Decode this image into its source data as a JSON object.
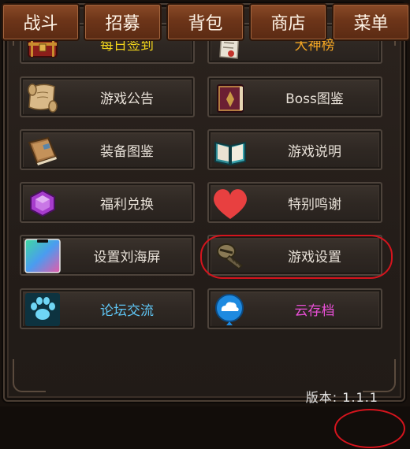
{
  "menu": {
    "buttons": [
      {
        "label": "每日签到",
        "color": "#f2d41a",
        "icon": "treasure-chest-icon"
      },
      {
        "label": "大神榜",
        "color": "#f5a623",
        "icon": "scroll-icon"
      },
      {
        "label": "游戏公告",
        "color": "#e8e1d8",
        "icon": "parchment-icon"
      },
      {
        "label": "Boss图鉴",
        "color": "#e8e1d8",
        "icon": "spellbook-icon"
      },
      {
        "label": "装备图鉴",
        "color": "#e8e1d8",
        "icon": "tome-icon"
      },
      {
        "label": "游戏说明",
        "color": "#e8e1d8",
        "icon": "open-book-icon"
      },
      {
        "label": "福利兑换",
        "color": "#e8e1d8",
        "icon": "purple-gem-icon"
      },
      {
        "label": "特别鸣谢",
        "color": "#e8e1d8",
        "icon": "heart-icon"
      },
      {
        "label": "设置刘海屏",
        "color": "#e8e1d8",
        "icon": "phone-screen-icon"
      },
      {
        "label": "游戏设置",
        "color": "#e8e1d8",
        "icon": "screw-icon"
      },
      {
        "label": "论坛交流",
        "color": "#5fc6f5",
        "icon": "paw-icon"
      },
      {
        "label": "云存档",
        "color": "#e84fd6",
        "icon": "cloud-save-icon"
      }
    ]
  },
  "version": {
    "text": "版本: 1.1.1"
  },
  "tabs": [
    {
      "label": "战斗"
    },
    {
      "label": "招募"
    },
    {
      "label": "背包"
    },
    {
      "label": "商店"
    },
    {
      "label": "菜单"
    }
  ],
  "colors": {
    "accent_red": "#d5141d",
    "tab_brown": "#6d3519"
  }
}
